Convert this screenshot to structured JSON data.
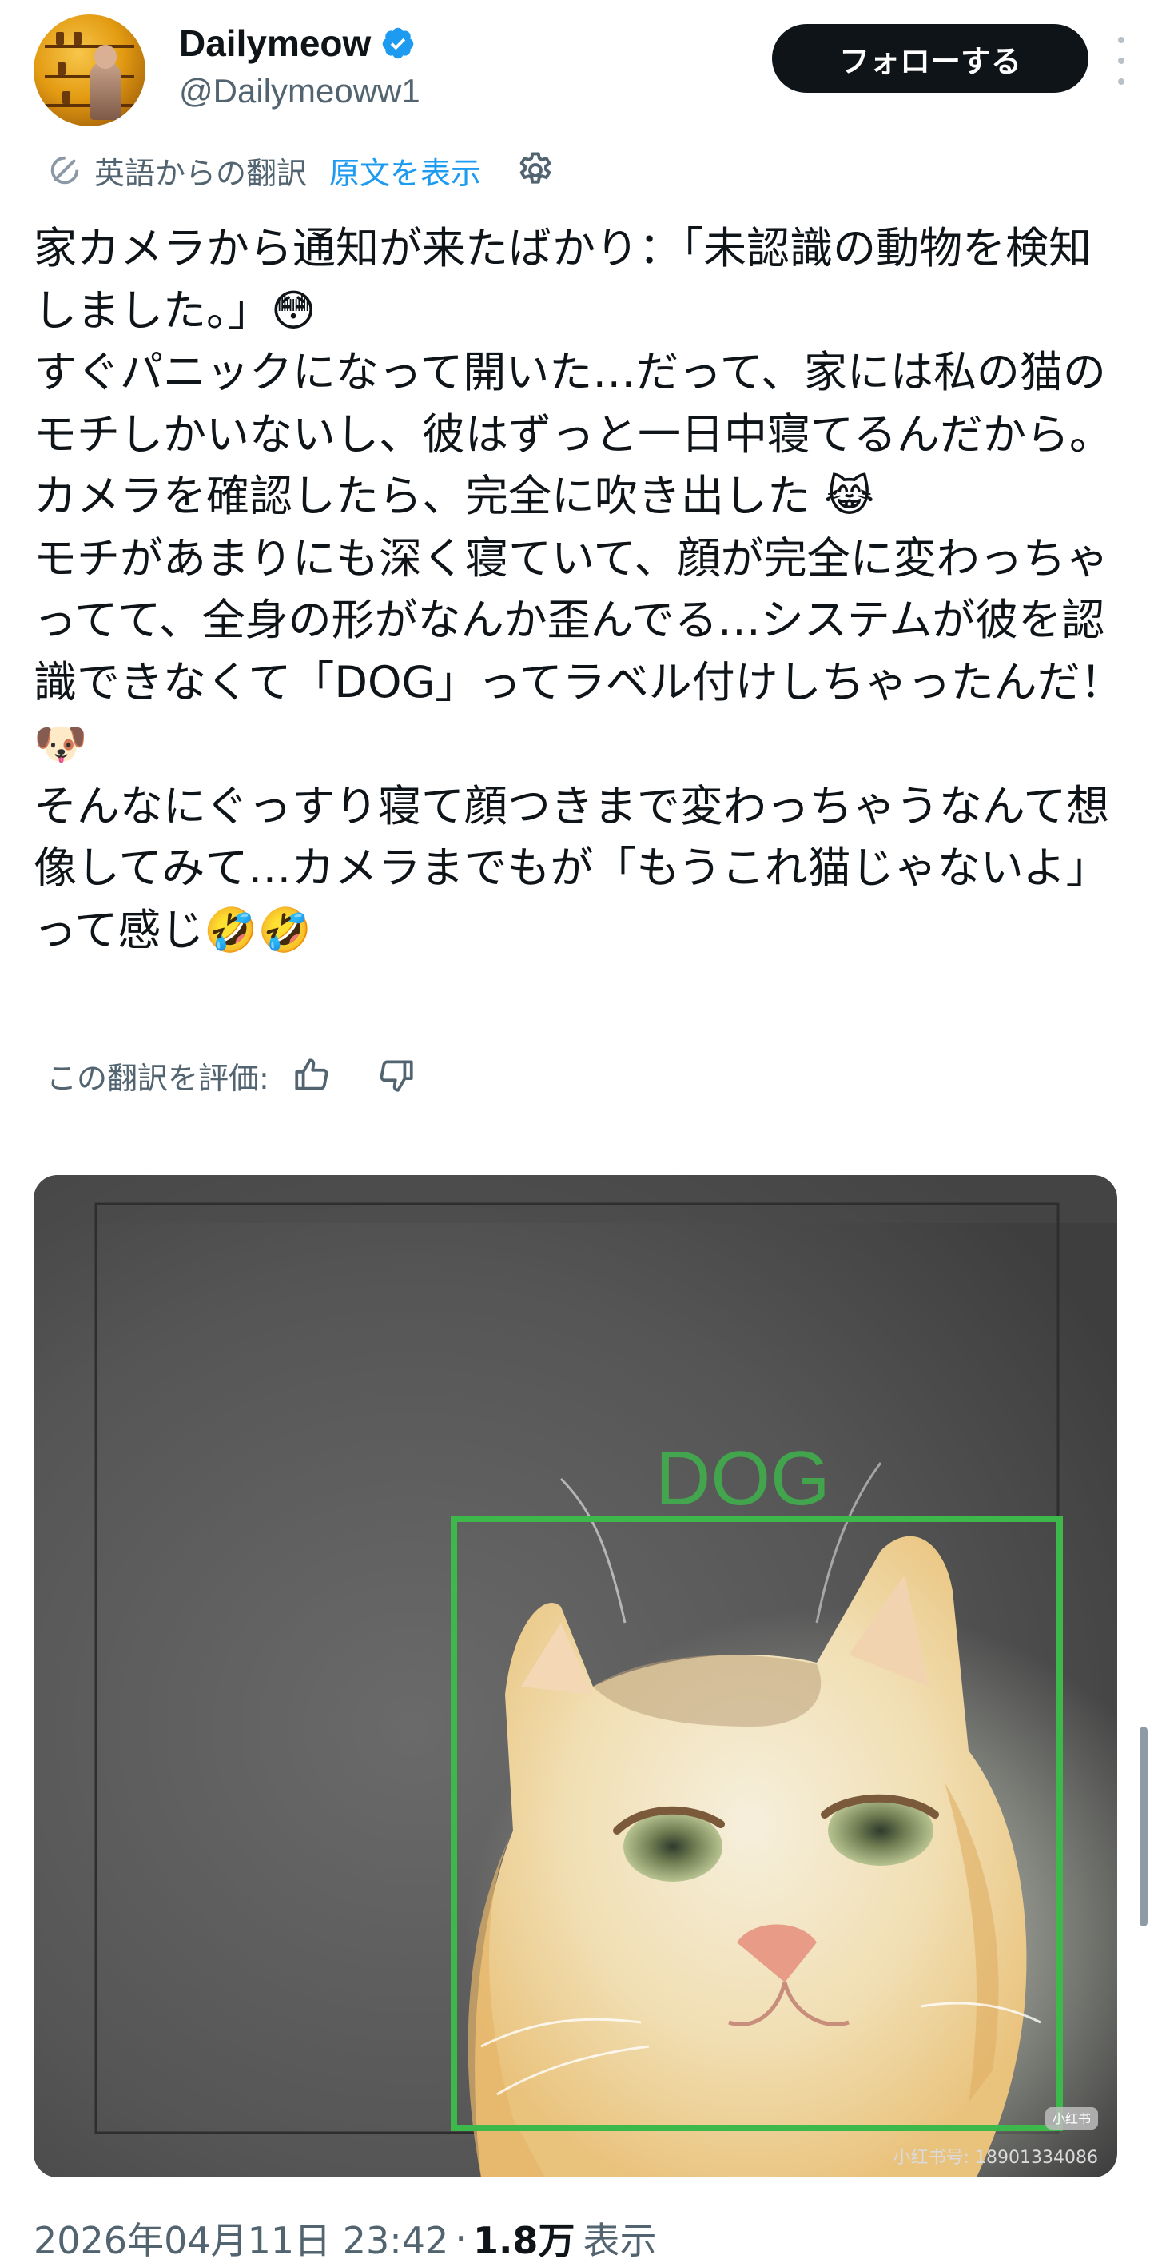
{
  "author": {
    "display_name": "Dailymeow",
    "handle": "@Dailymeoww1",
    "avatar_icon": "profile-photo",
    "verified_icon": "verified-badge-icon",
    "verified_color": "#1d9bf0"
  },
  "follow": {
    "label": "フォローする"
  },
  "more": {
    "icon": "more-vertical-icon"
  },
  "translation": {
    "label": "英語からの翻訳",
    "show_original": "原文を表示",
    "settings_icon": "gear-icon"
  },
  "tweet": {
    "lines": [
      "家カメラから通知が来たばかり：「未認識の動物を検知しました。」😳",
      "すぐパニックになって開いた…だって、家には私の猫のモチしかいないし、彼はずっと一日中寝てるんだから。",
      "カメラを確認したら、完全に吹き出した 😹",
      "モチがあまりにも深く寝ていて、顔が完全に変わっちゃってて、全身の形がなんか歪んでる…システムが彼を認識できなくて「DOG」ってラベル付けしちゃったんだ！🐶",
      "そんなにぐっすり寝て顔つきまで変わっちゃうなんて想像してみて…カメラまでもが「もうこれ猫じゃないよ」って感じ🤣🤣"
    ]
  },
  "rating": {
    "label": "この翻訳を評価:",
    "thumbs_up_icon": "thumbs-up-icon",
    "thumbs_down_icon": "thumbs-down-icon"
  },
  "media": {
    "detection_label": "DOG",
    "detection_color": "#3db84a",
    "watermark_badge": "小红书",
    "watermark_id": "小红书号: 18901334086"
  },
  "meta": {
    "timestamp": "2026年04月11日 23:42",
    "separator": "·",
    "views_count": "1.8万",
    "views_label": "表示"
  }
}
